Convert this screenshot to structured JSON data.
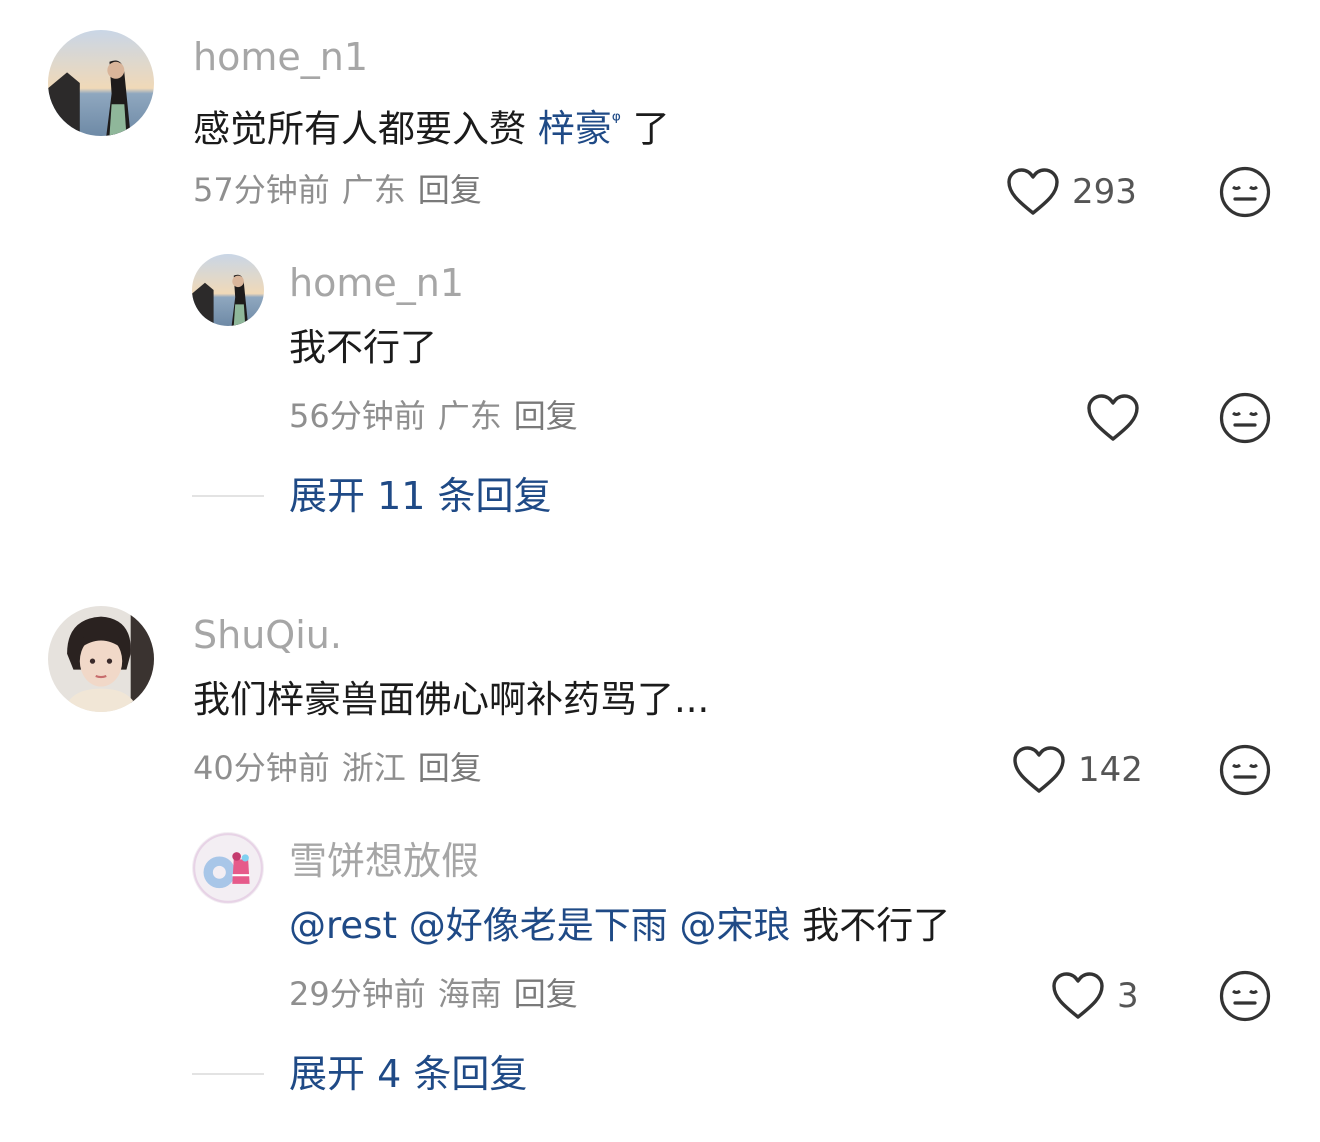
{
  "comments": [
    {
      "user": "home_n1",
      "text_before": "感觉所有人都要入赘 ",
      "text_link": "梓豪",
      "text_link_mark": "ᵠ",
      "text_after": " 了",
      "time": "57分钟前",
      "location": "广东",
      "reply_label": "回复",
      "likes": "293",
      "reply": {
        "user": "home_n1",
        "text": "我不行了",
        "time": "56分钟前",
        "location": "广东",
        "reply_label": "回复",
        "likes": ""
      },
      "expand_label": "展开 11 条回复"
    },
    {
      "user": "ShuQiu.",
      "text": "我们梓豪兽面佛心啊补药骂了...",
      "time": "40分钟前",
      "location": "浙江",
      "reply_label": "回复",
      "likes": "142",
      "reply": {
        "user": "雪饼想放假",
        "mentions": [
          "@rest",
          "@好像老是下雨",
          "@宋琅"
        ],
        "text": "我不行了",
        "time": "29分钟前",
        "location": "海南",
        "reply_label": "回复",
        "likes": "3"
      },
      "expand_label": "展开 4 条回复"
    }
  ],
  "icons": {
    "like": "heart-outline-icon",
    "dislike": "neutral-face-icon"
  },
  "colors": {
    "link": "#1f4a86",
    "username": "#a6a6a6",
    "meta": "#8f8f8f"
  }
}
